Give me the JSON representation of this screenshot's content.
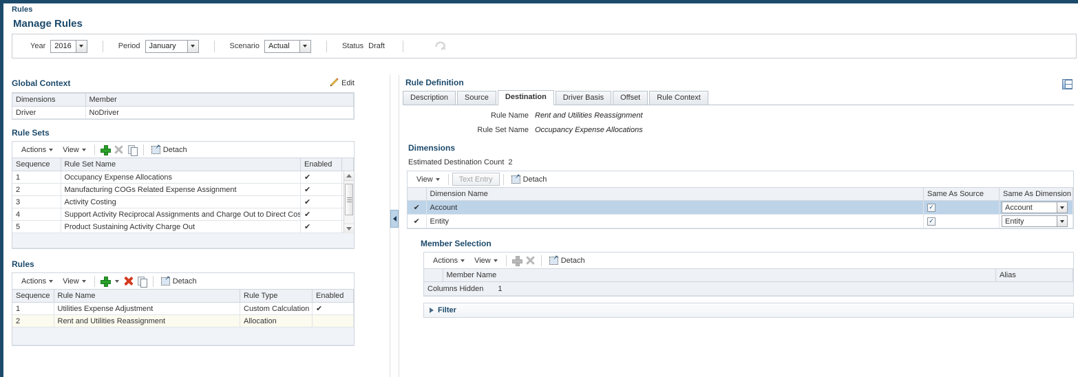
{
  "breadcrumb": "Rules",
  "page_title": "Manage Rules",
  "context_bar": {
    "year_label": "Year",
    "year_value": "2016",
    "period_label": "Period",
    "period_value": "January",
    "scenario_label": "Scenario",
    "scenario_value": "Actual",
    "status_label": "Status",
    "status_value": "Draft",
    "refresh_icon": "refresh-icon"
  },
  "global_context": {
    "title": "Global Context",
    "edit_label": "Edit",
    "edit_icon": "pencil-icon",
    "columns": [
      "Dimensions",
      "Member"
    ],
    "rows": [
      {
        "dimension": "Driver",
        "member": "NoDriver"
      }
    ]
  },
  "rule_sets": {
    "title": "Rule Sets",
    "toolbar": {
      "actions_label": "Actions",
      "view_label": "View",
      "add_icon": "plus-icon",
      "delete_icon": "delete-x-icon",
      "copy_icon": "copy-icon",
      "detach_label": "Detach",
      "detach_icon": "detach-icon"
    },
    "columns": [
      "Sequence",
      "Rule Set Name",
      "Enabled"
    ],
    "rows": [
      {
        "sequence": "1",
        "name": "Occupancy Expense Allocations",
        "enabled": "✔"
      },
      {
        "sequence": "2",
        "name": "Manufacturing COGs Related Expense Assignment",
        "enabled": "✔"
      },
      {
        "sequence": "3",
        "name": "Activity Costing",
        "enabled": "✔"
      },
      {
        "sequence": "4",
        "name": "Support Activity Reciprocal Assignments and Charge Out to Direct Cost C",
        "enabled": "✔"
      },
      {
        "sequence": "5",
        "name": "Product Sustaining Activity Charge Out",
        "enabled": "✔"
      }
    ]
  },
  "rules": {
    "title": "Rules",
    "toolbar": {
      "actions_label": "Actions",
      "view_label": "View",
      "add_icon": "plus-icon",
      "add_dropdown_icon": "chevron-down-icon",
      "delete_icon": "delete-x-red-icon",
      "copy_icon": "copy-icon",
      "detach_label": "Detach",
      "detach_icon": "detach-icon"
    },
    "columns": [
      "Sequence",
      "Rule Name",
      "Rule Type",
      "Enabled"
    ],
    "rows": [
      {
        "sequence": "1",
        "name": "Utilities Expense Adjustment",
        "type": "Custom Calculation",
        "enabled": "✔"
      },
      {
        "sequence": "2",
        "name": "Rent and Utilities Reassignment",
        "type": "Allocation",
        "enabled": ""
      }
    ]
  },
  "rule_definition": {
    "title": "Rule Definition",
    "save_icon": "save-icon",
    "tabs": [
      {
        "label": "Description",
        "active": false
      },
      {
        "label": "Source",
        "active": false
      },
      {
        "label": "Destination",
        "active": true
      },
      {
        "label": "Driver Basis",
        "active": false
      },
      {
        "label": "Offset",
        "active": false
      },
      {
        "label": "Rule Context",
        "active": false
      }
    ],
    "rule_name_label": "Rule Name",
    "rule_name_value": "Rent and Utilities Reassignment",
    "rule_set_name_label": "Rule Set Name",
    "rule_set_name_value": "Occupancy Expense Allocations"
  },
  "dimensions": {
    "title": "Dimensions",
    "estimated_label": "Estimated Destination Count",
    "estimated_value": "2",
    "toolbar": {
      "view_label": "View",
      "text_entry_label": "Text Entry",
      "detach_label": "Detach",
      "detach_icon": "detach-icon"
    },
    "columns": [
      "",
      "Dimension Name",
      "Same As Source",
      "Same As Dimension"
    ],
    "rows": [
      {
        "check": "✔",
        "name": "Account",
        "same_as_source": true,
        "same_as_dimension": "Account",
        "selected": true
      },
      {
        "check": "✔",
        "name": "Entity",
        "same_as_source": true,
        "same_as_dimension": "Entity",
        "selected": false
      }
    ]
  },
  "member_selection": {
    "title": "Member Selection",
    "toolbar": {
      "actions_label": "Actions",
      "view_label": "View",
      "add_icon": "plus-icon",
      "delete_icon": "delete-x-icon",
      "detach_label": "Detach",
      "detach_icon": "detach-icon"
    },
    "columns": [
      "",
      "Member Name",
      "Alias"
    ],
    "columns_hidden_label": "Columns Hidden",
    "columns_hidden_count": "1"
  },
  "filter": {
    "label": "Filter",
    "expand_icon": "triangle-right-icon"
  },
  "colors": {
    "title_navy": "#1c4a6b",
    "frame_navy": "#1c4a6b",
    "row_selected": "#bcd3e8",
    "header_grey": "#eef1f5",
    "row_yellow": "#fcfbef",
    "add_green": "#2aa02a",
    "delete_red": "#d43b20"
  }
}
